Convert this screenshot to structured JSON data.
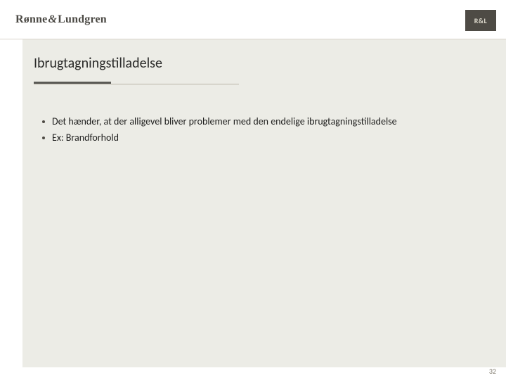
{
  "header": {
    "brand_first": "Rønne",
    "brand_amp": "&",
    "brand_last": "Lundgren",
    "logo_text": "R&L"
  },
  "title": "Ibrugtagningstilladelse",
  "bullets": [
    "Det hænder, at der alligevel bliver problemer med den endelige ibrugtagningstilladelse",
    "Ex: Brandforhold"
  ],
  "page_number": "32"
}
